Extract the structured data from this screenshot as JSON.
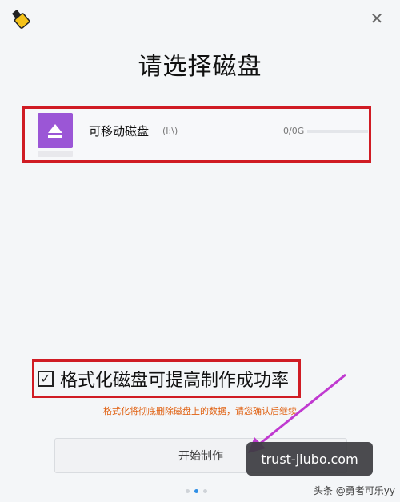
{
  "header": {
    "title": "请选择磁盘",
    "close_icon": "close-icon",
    "app_icon": "usb-drive-icon"
  },
  "disk": {
    "name": "可移动磁盘",
    "drive": "(I:\\)",
    "size": "0/0G",
    "icon": "eject-icon",
    "accent_color": "#9b56d6"
  },
  "format": {
    "checked": true,
    "label": "格式化磁盘可提高制作成功率",
    "warning": "格式化将彻底删除磁盘上的数据，请您确认后继续"
  },
  "actions": {
    "start_label": "开始制作"
  },
  "pager": {
    "count": 3,
    "active": 1
  },
  "overlay": {
    "watermark": "trust-jiubo.com",
    "credit": "头条 @勇者可乐yy"
  },
  "colors": {
    "highlight_border": "#d01c24",
    "warning_text": "#e06010",
    "active_dot": "#2f8fe6"
  }
}
